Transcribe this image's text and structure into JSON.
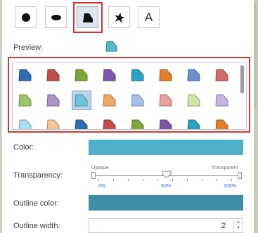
{
  "shape_types": [
    {
      "id": "circle",
      "icon": "circle-icon"
    },
    {
      "id": "ellipse",
      "icon": "ellipse-icon"
    },
    {
      "id": "custom",
      "icon": "custom-shape-icon",
      "selected": true
    },
    {
      "id": "star",
      "icon": "star-icon"
    },
    {
      "id": "text",
      "icon": "text-icon",
      "label": "A"
    }
  ],
  "preview": {
    "label": "Preview:",
    "fill": "#5bb8cf",
    "outline": "#2f7f99"
  },
  "gallery": {
    "rows": [
      [
        "#2f6db6",
        "#c24a4a",
        "#7ea63a",
        "#7c58a8",
        "#2aa2c6",
        "#e47e2a",
        "#6a90cc",
        "#d46a6a"
      ],
      [
        "#9cc66a",
        "#ad92c8",
        "#6ec6dc",
        "#f0a860",
        "#a6c2ea",
        "#ee9e9e",
        "#cfe6a8",
        "#c8b4e4"
      ],
      [
        "#a6e0ee",
        "#f6c48e",
        "#2f6db6",
        "#c24a4a",
        "#7ea63a",
        "#7c58a8",
        "#2aa2c6",
        "#e47e2a"
      ]
    ],
    "selected_row": 1,
    "selected_col": 2
  },
  "color": {
    "label": "Color:",
    "value": "#4bb0c8"
  },
  "transparency": {
    "label": "Transparency:",
    "min_label": "Opaque",
    "max_label": "Transparent",
    "ticks": [
      "0%",
      "50%",
      "100%"
    ],
    "value_percent": 50
  },
  "outline_color": {
    "label": "Outline color:",
    "value": "#3e8fa6"
  },
  "outline_width": {
    "label": "Outline width:",
    "value": "2"
  }
}
